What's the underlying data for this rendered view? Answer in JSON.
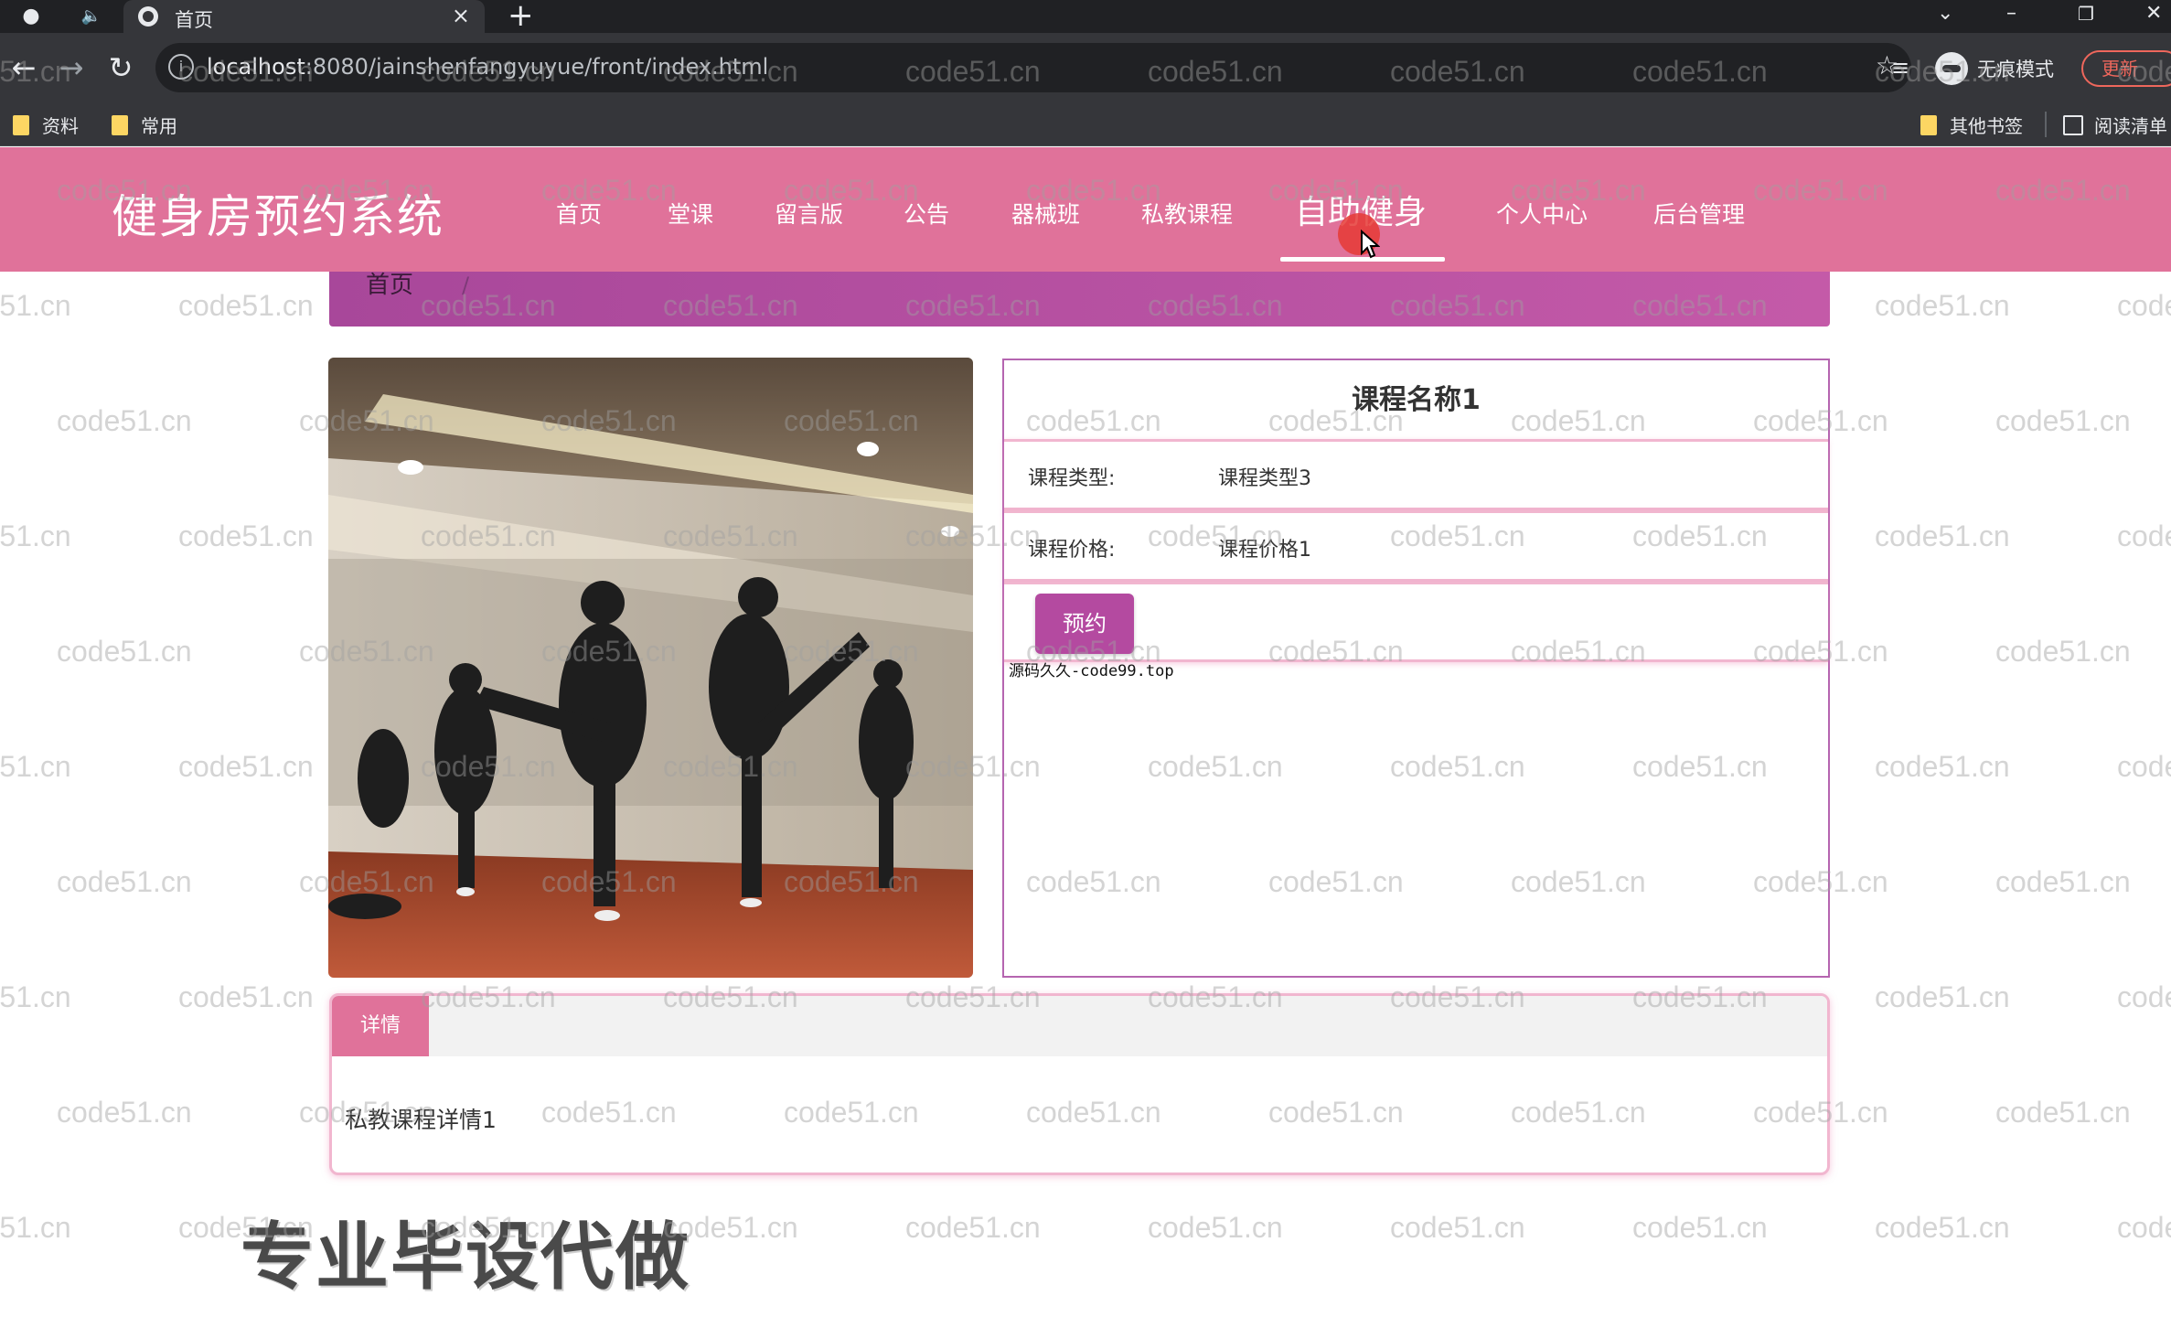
{
  "browser": {
    "tab_title": "首页",
    "url_host": "localhost",
    "url_rest": ":8080/jainshenfangyuyue/front/index.html",
    "incognito_label": "无痕模式",
    "update_label": "更新",
    "bookmarks": [
      "资料",
      "常用"
    ],
    "other_bookmarks": "其他书签",
    "reading_list": "阅读清单"
  },
  "site": {
    "title": "健身房预约系统",
    "nav": [
      "首页",
      "堂课",
      "留言版",
      "公告",
      "器械班",
      "私教课程",
      "自助健身",
      "个人中心",
      "后台管理"
    ],
    "active_nav": "自助健身"
  },
  "breadcrumb": {
    "home": "首页",
    "separator": "/"
  },
  "course": {
    "name": "课程名称1",
    "type_label": "课程类型:",
    "type_value": "课程类型3",
    "price_label": "课程价格:",
    "price_value": "课程价格1",
    "book_button": "预约",
    "source_note": "源码久久-code99.top"
  },
  "detail": {
    "tab_label": "详情",
    "text": "私教课程详情1"
  },
  "overlay": {
    "ad_text": "专业毕设代做",
    "watermark": "code51.cn"
  },
  "colors": {
    "header_pink": "#e0729a",
    "breadcrumb_purple": "#b44aa0",
    "button_purple": "#b44aa0",
    "row_border_pink": "#f1b6cf"
  }
}
